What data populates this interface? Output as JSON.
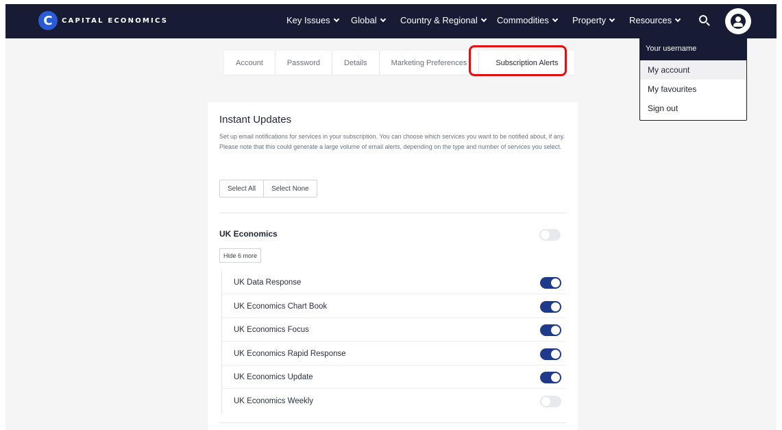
{
  "brand": {
    "logo_glyph": "C",
    "name": "CAPITAL ECONOMICS"
  },
  "nav": {
    "items": [
      {
        "label": "Key Issues"
      },
      {
        "label": "Global"
      },
      {
        "label": "Country & Regional"
      },
      {
        "label": "Commodities"
      },
      {
        "label": "Property"
      },
      {
        "label": "Resources"
      }
    ]
  },
  "tabs": [
    {
      "label": "Account"
    },
    {
      "label": "Password"
    },
    {
      "label": "Details"
    },
    {
      "label": "Marketing Preferences"
    },
    {
      "label": "Subscription Alerts",
      "active": true
    }
  ],
  "user_menu": {
    "header": "Your username",
    "items": [
      {
        "label": "My account"
      },
      {
        "label": "My favourites"
      },
      {
        "label": "Sign out"
      }
    ]
  },
  "instant_updates": {
    "title": "Instant Updates",
    "description": "Set up email notifications for services in your subscription. You can choose which services you want to be notified about, if any. Please note that this could generate a large volume of email alerts, depending on the type and number of services you select.",
    "select_all": "Select All",
    "select_none": "Select None",
    "section": {
      "title": "UK Economics",
      "enabled": false,
      "toggle_more": "Hide 6 more",
      "services": [
        {
          "label": "UK Data Response",
          "enabled": true
        },
        {
          "label": "UK Economics Chart Book",
          "enabled": true
        },
        {
          "label": "UK Economics Focus",
          "enabled": true
        },
        {
          "label": "UK Economics Rapid Response",
          "enabled": true
        },
        {
          "label": "UK Economics Update",
          "enabled": true
        },
        {
          "label": "UK Economics Weekly",
          "enabled": false
        }
      ]
    }
  },
  "colors": {
    "nav_bg": "#171b34",
    "toggle_on": "#1f3a8a",
    "highlight": "#e01010",
    "logo": "#2a5bd7"
  }
}
